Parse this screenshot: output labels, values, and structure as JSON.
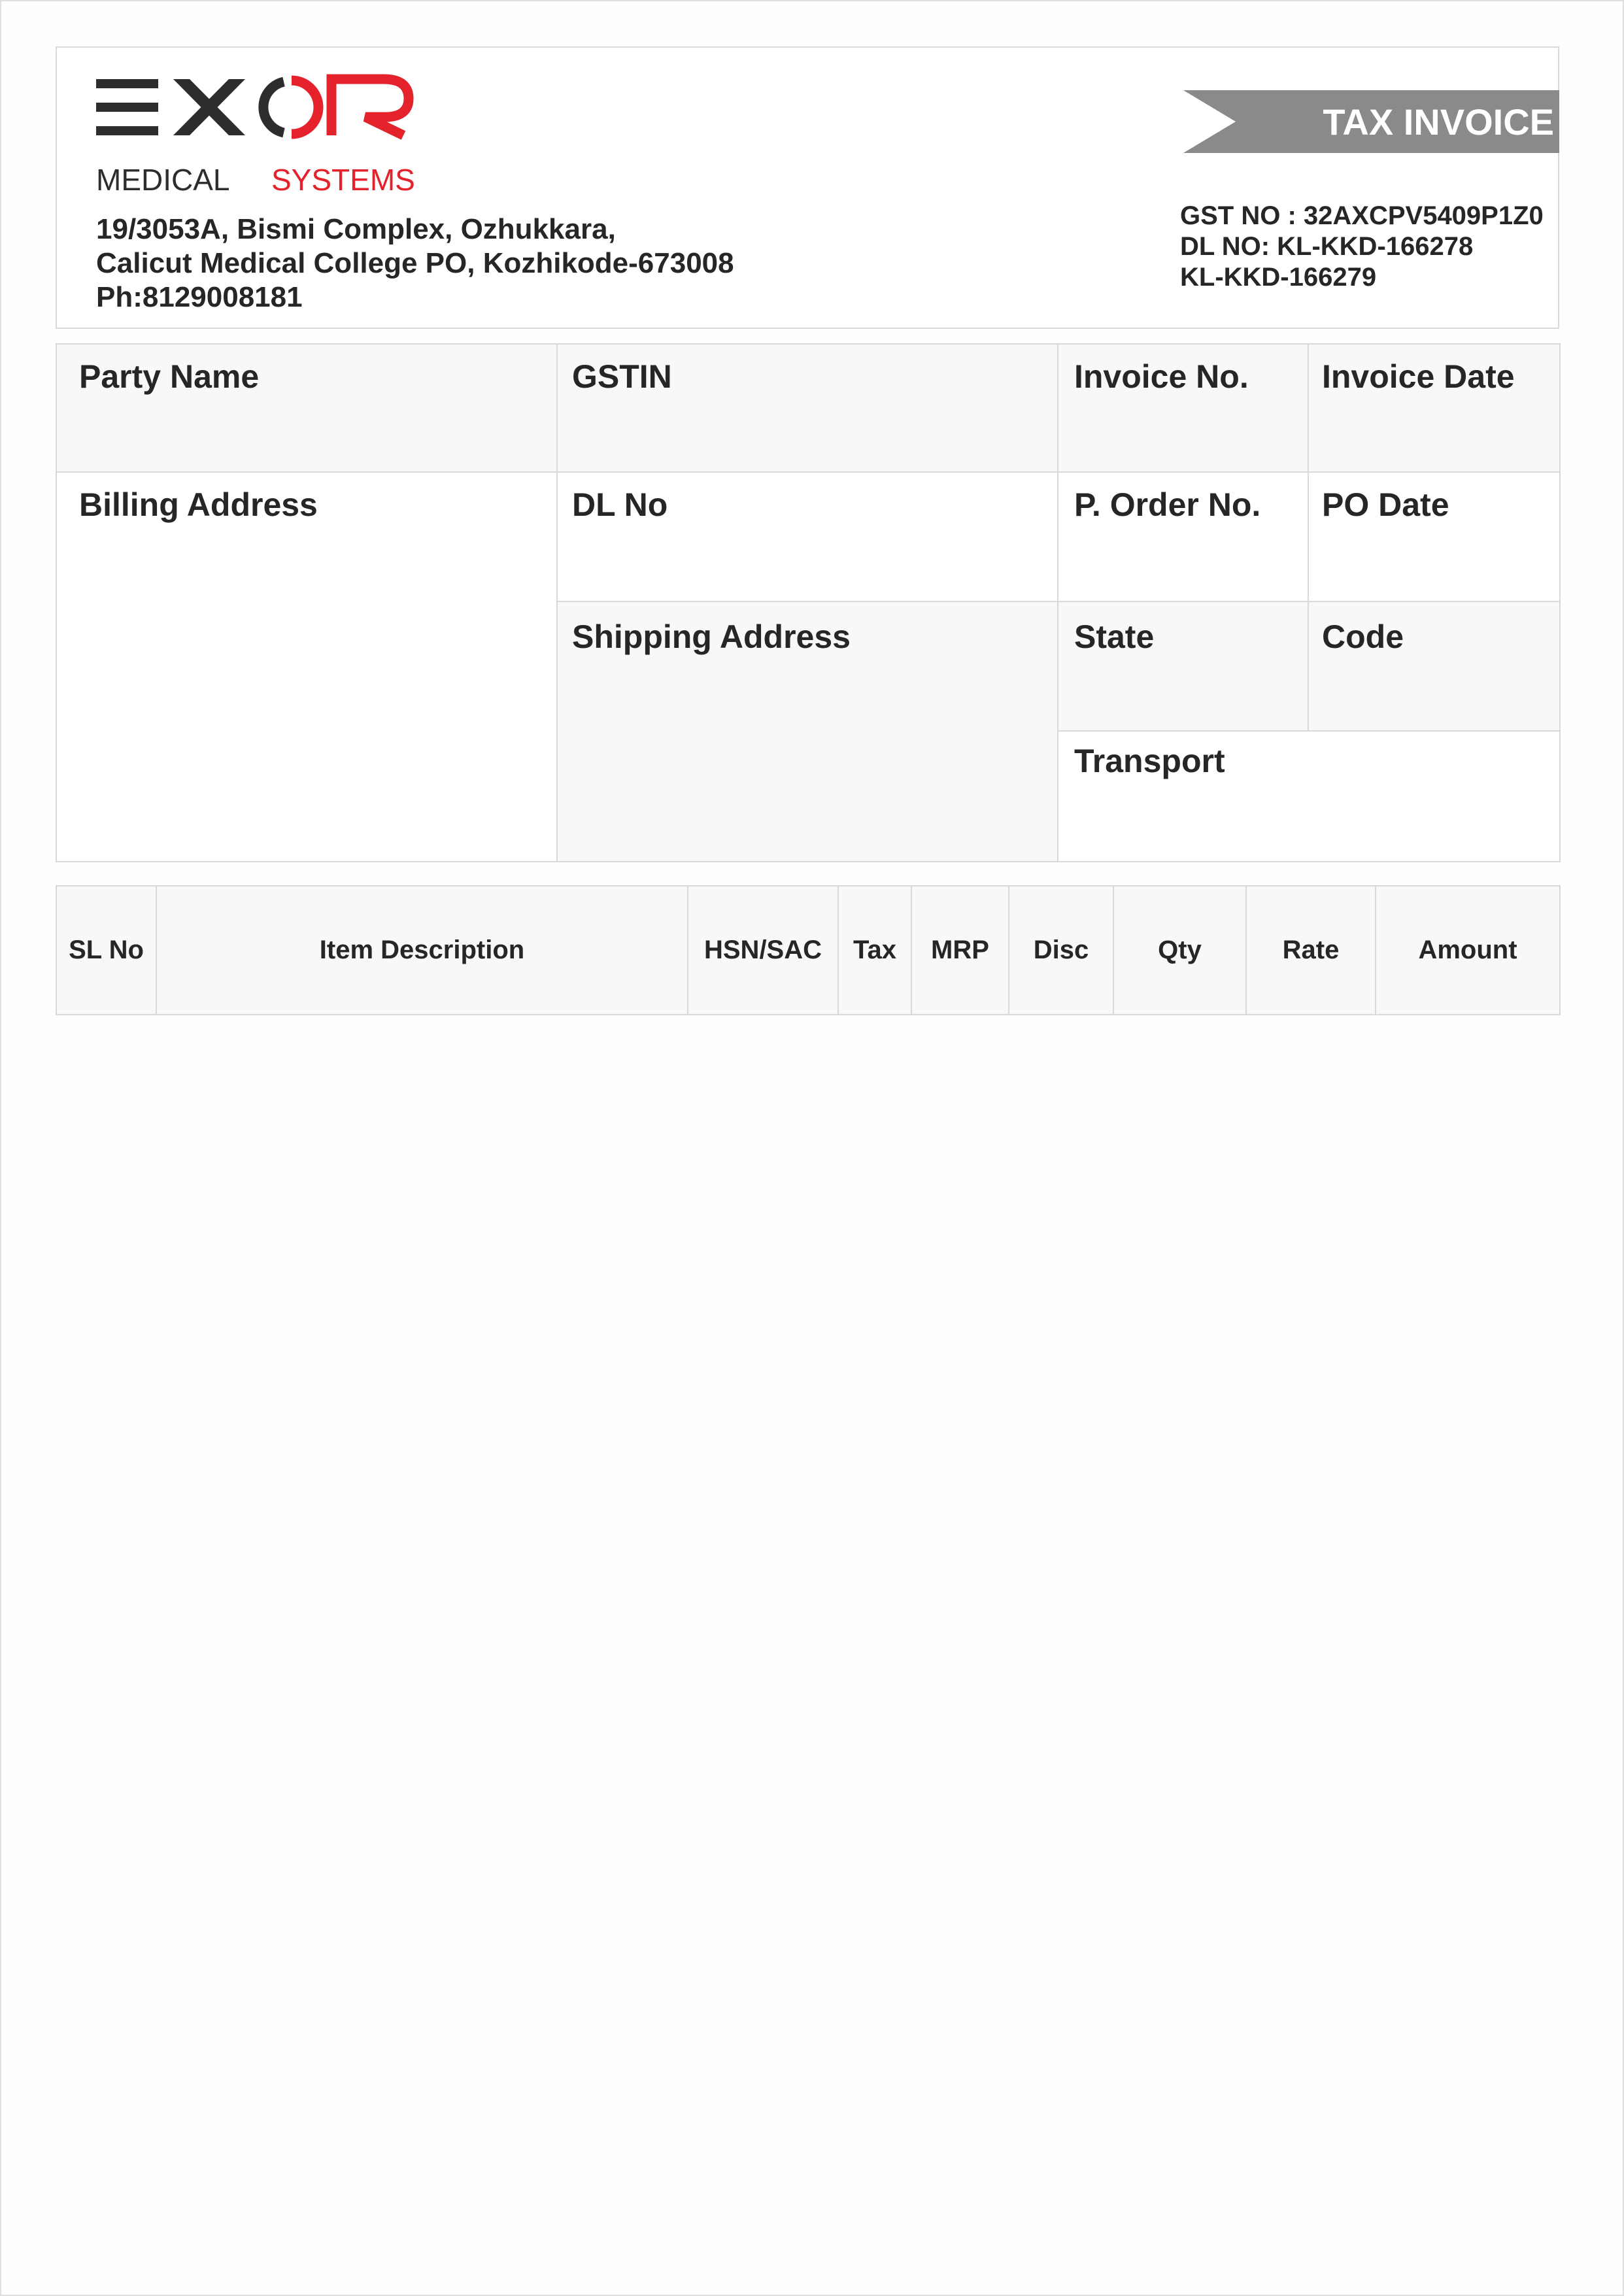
{
  "company": {
    "logo_word": "EXOR",
    "logo_sub_left": "MEDICAL",
    "logo_sub_right": "SYSTEMS",
    "address_lines": [
      "19/3053A, Bismi Complex, Ozhukkara,",
      "Calicut Medical College PO, Kozhikode-673008",
      "Ph:8129008181"
    ],
    "colors": {
      "dark": "#2d2d2d",
      "red": "#e3222b",
      "ribbon": "#8a8a8a"
    }
  },
  "document": {
    "title": "TAX INVOICE",
    "registrations": [
      "GST NO : 32AXCPV5409P1Z0",
      "DL NO: KL-KKD-166278",
      "KL-KKD-166279"
    ]
  },
  "fields": {
    "party_name": "Party Name",
    "gstin": "GSTIN",
    "invoice_no": "Invoice No.",
    "invoice_date": "Invoice Date",
    "billing_address": "Billing Address",
    "dl_no": "DL No",
    "p_order_no": "P. Order No.",
    "po_date": "PO Date",
    "shipping_address": "Shipping Address",
    "state": "State",
    "code": "Code",
    "transport": "Transport"
  },
  "items_table": {
    "columns": [
      "SL No",
      "Item Description",
      "HSN/SAC",
      "Tax",
      "MRP",
      "Disc",
      "Qty",
      "Rate",
      "Amount"
    ]
  }
}
